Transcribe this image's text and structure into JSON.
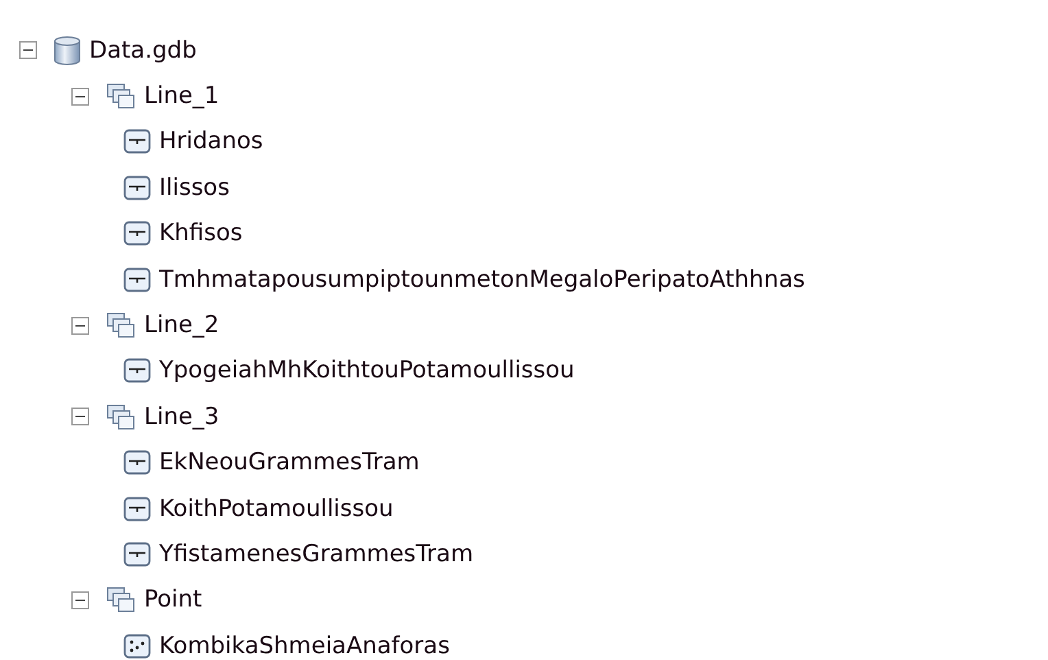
{
  "tree": [
    {
      "label": "Data.gdb",
      "kind": "database",
      "expanded": true,
      "children": [
        {
          "label": "Line_1",
          "kind": "dataset",
          "expanded": true,
          "children": [
            {
              "label": "Hridanos",
              "kind": "line"
            },
            {
              "label": "Ilissos",
              "kind": "line"
            },
            {
              "label": "Khfisos",
              "kind": "line"
            },
            {
              "label": "TmhmatapousumpiptounmetonMegaloPeripatoAthhnas",
              "kind": "line"
            }
          ]
        },
        {
          "label": "Line_2",
          "kind": "dataset",
          "expanded": true,
          "children": [
            {
              "label": "YpogeiahMhKoithtouPotamoullissou",
              "kind": "line"
            }
          ]
        },
        {
          "label": "Line_3",
          "kind": "dataset",
          "expanded": true,
          "children": [
            {
              "label": "EkNeouGrammesTram",
              "kind": "line"
            },
            {
              "label": "KoithPotamoullissou",
              "kind": "line"
            },
            {
              "label": "YfistamenesGrammesTram",
              "kind": "line"
            }
          ]
        },
        {
          "label": "Point",
          "kind": "dataset",
          "expanded": true,
          "children": [
            {
              "label": "KombikaShmeiaAnaforas",
              "kind": "point"
            }
          ]
        }
      ]
    }
  ]
}
